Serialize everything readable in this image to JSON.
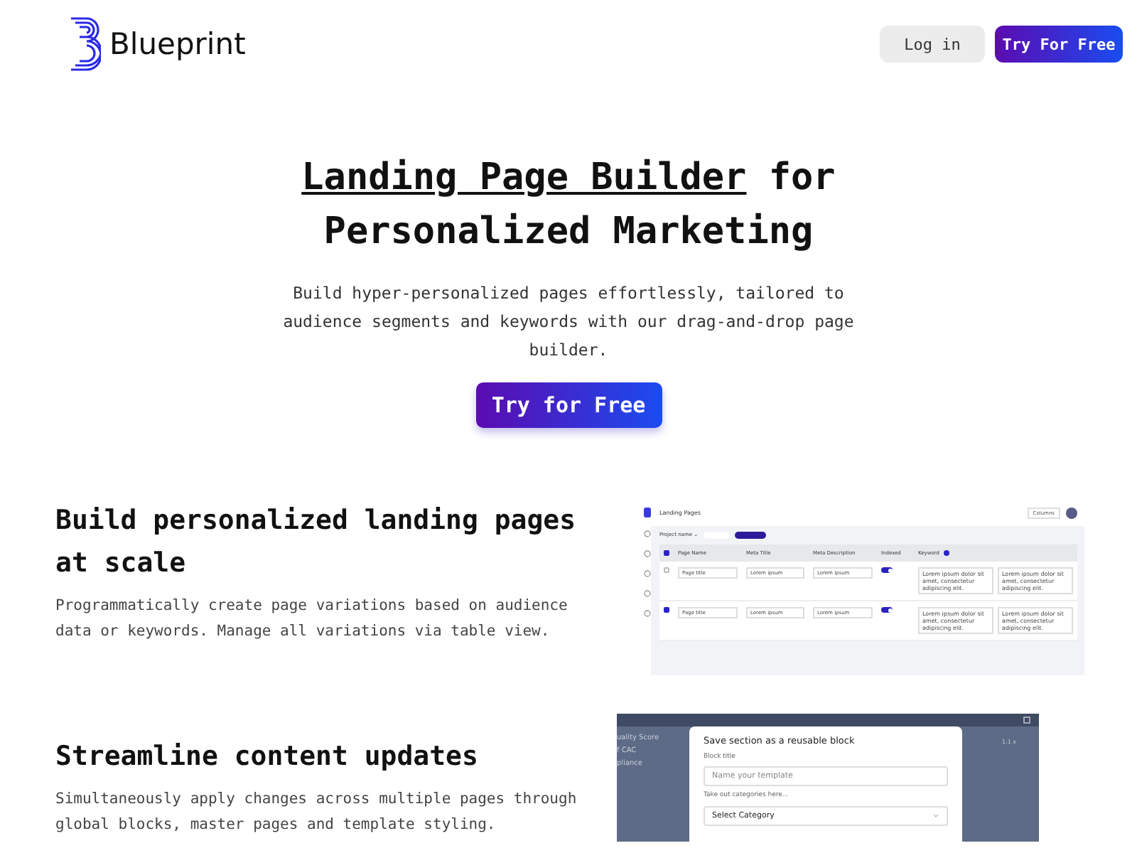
{
  "header": {
    "brand": "Blueprint",
    "buttons": [
      {
        "label": "Log in",
        "kind": "secondary"
      },
      {
        "label": "Try For Free",
        "kind": "primary"
      }
    ]
  },
  "hero": {
    "title_link": "Landing Page Builder",
    "title_rest": " for",
    "title_line2": "Personalized Marketing",
    "subtitle": "Build hyper-personalized pages effortlessly, tailored to audience segments and keywords with our drag-and-drop page builder.",
    "cta": "Try for Free"
  },
  "features": [
    {
      "title": "Build personalized landing pages at scale",
      "text": "Programmatically create page variations based on audience data or keywords. Manage all variations via table view.",
      "screen": {
        "kind": "table",
        "title": "Landing Pages",
        "columns_button": "Columns",
        "filter": "Project name ⌄",
        "header_checked": true,
        "columns": [
          "Page Name",
          "Meta Title",
          "Meta Description",
          "Indexed",
          "Keyword"
        ],
        "rows": [
          {
            "selected": false,
            "cells": [
              "Page title",
              "Lorem ipsum",
              "Lorem ipsum"
            ],
            "indexed": true,
            "notes": [
              "Lorem ipsum dolor sit amet, consectetur adipiscing elit.",
              "Lorem ipsum dolor sit amet, consectetur adipiscing elit."
            ]
          },
          {
            "selected": true,
            "cells": [
              "Page title",
              "Lorem ipsum",
              "Lorem ipsum"
            ],
            "indexed": true,
            "notes": [
              "Lorem ipsum dolor sit amet, consectetur adipiscing elit.",
              "Lorem ipsum dolor sit amet, consectetur adipiscing elit."
            ]
          }
        ]
      }
    },
    {
      "title": "Streamline content updates",
      "text": "Simultaneously apply changes across multiple pages through global blocks, master pages and template styling.",
      "screen": {
        "kind": "modal",
        "background_left": [
          "uality Score",
          "f CAC",
          "pliance"
        ],
        "background_right": "1.1 x",
        "modal_title": "Save section as a reusable block",
        "field_label": "Block title",
        "field_placeholder": "Name your template",
        "select_label": "Take out categories here...",
        "select_value": "Select Category"
      }
    }
  ]
}
